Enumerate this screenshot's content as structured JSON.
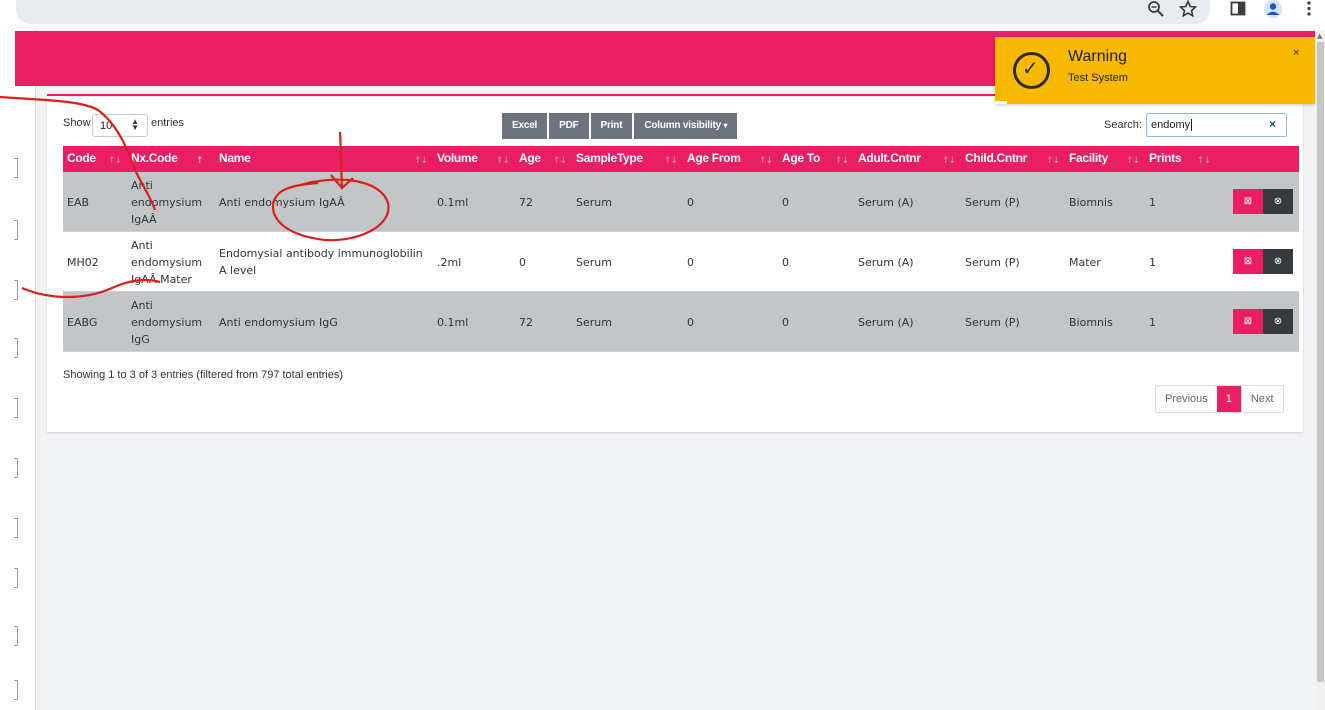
{
  "browser": {
    "icons": [
      "zoom-icon",
      "star-icon",
      "side-panel-icon",
      "profile-icon",
      "menu-icon"
    ]
  },
  "table_controls": {
    "show_label": "Show",
    "page_length": "10",
    "entries_label": "entries",
    "buttons": [
      "Excel",
      "PDF",
      "Print",
      "Column visibility"
    ],
    "column_visibility_caret": "▾",
    "search_label": "Search:",
    "search_value": "endomy",
    "search_clear": "×"
  },
  "table": {
    "columns": [
      "Code",
      "Nx.Code",
      "Name",
      "Volume",
      "Age",
      "SampleType",
      "Age From",
      "Age To",
      "Adult.Cntnr",
      "Child.Cntnr",
      "Facility",
      "Prints",
      ""
    ],
    "sort_indicator": "↑↓",
    "active_sort_indicator": "↑",
    "rows": [
      {
        "code": "EAB",
        "nx_code": "Anti endomysium IgAÂ",
        "name": "Anti endomysium IgAÂ",
        "volume": "0.1ml",
        "age": "72",
        "sample_type": "Serum",
        "age_from": "0",
        "age_to": "0",
        "adult_cntnr": "Serum (A)",
        "child_cntnr": "Serum (P)",
        "facility": "Biomnis",
        "prints": "1"
      },
      {
        "code": "MH02",
        "nx_code": "Anti endomysium IgAÂ Mater",
        "name": "Endomysial antibody immunoglobilin A level",
        "volume": ".2ml",
        "age": "0",
        "sample_type": "Serum",
        "age_from": "0",
        "age_to": "0",
        "adult_cntnr": "Serum (A)",
        "child_cntnr": "Serum (P)",
        "facility": "Mater",
        "prints": "1"
      },
      {
        "code": "EABG",
        "nx_code": "Anti endomysium IgG",
        "name": "Anti endomysium IgG",
        "volume": "0.1ml",
        "age": "72",
        "sample_type": "Serum",
        "age_from": "0",
        "age_to": "0",
        "adult_cntnr": "Serum (A)",
        "child_cntnr": "Serum (P)",
        "facility": "Biomnis",
        "prints": "1"
      }
    ],
    "edit_glyph": "⊠",
    "delete_glyph": "⊗"
  },
  "footer": {
    "info": "Showing 1 to 3 of 3 entries (filtered from 797 total entries)",
    "previous": "Previous",
    "page": "1",
    "next": "Next"
  },
  "toast": {
    "title": "Warning",
    "message": "Test System",
    "close": "×",
    "check_glyph": "✓"
  },
  "colors": {
    "accent": "#e91e63",
    "toast_bg": "#f8b900",
    "button_grey": "#6c757d",
    "row_grey": "#c2c6c8",
    "annotation_red": "#d9201c"
  }
}
